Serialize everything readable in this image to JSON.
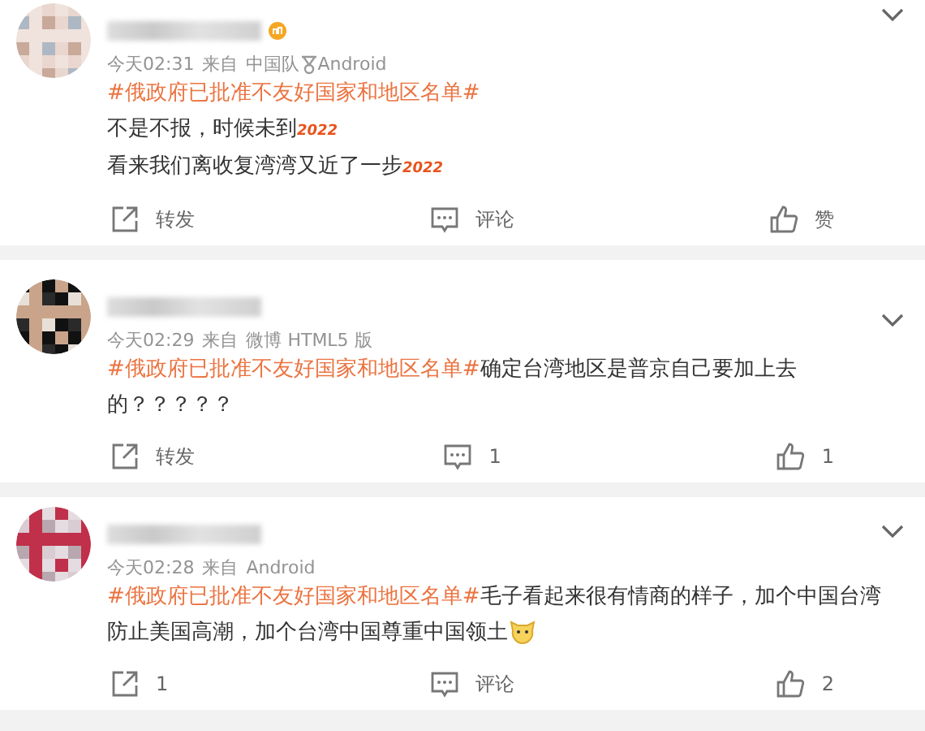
{
  "comments": [
    {
      "badge": true,
      "time": "今天02:31",
      "from": "来自",
      "source": [
        {
          "kind": "text",
          "text": "中国队"
        },
        {
          "kind": "icon"
        },
        {
          "kind": "text",
          "text": "Android"
        }
      ],
      "paragraphs": [
        [
          {
            "kind": "topic",
            "text": "#俄政府已批准不友好国家和地区名单#"
          }
        ],
        [
          {
            "kind": "text",
            "text": "不是不报，时候未到"
          },
          {
            "kind": "sticker",
            "text": "2022"
          }
        ],
        [
          {
            "kind": "text",
            "text": "看来我们离收复湾湾又近了一步"
          },
          {
            "kind": "sticker",
            "text": "2022"
          }
        ]
      ],
      "repost": "转发",
      "comment": "评论",
      "like": "赞"
    },
    {
      "badge": false,
      "time": "今天02:29",
      "from": "来自",
      "source": [
        {
          "kind": "text",
          "text": "微博 HTML5 版"
        }
      ],
      "paragraphs": [
        [
          {
            "kind": "topic",
            "text": "#俄政府已批准不友好国家和地区名单#"
          },
          {
            "kind": "text",
            "text": "确定台湾地区是普京自己要加上去的？？？？？"
          }
        ]
      ],
      "repost": "转发",
      "comment": "1",
      "like": "1"
    },
    {
      "badge": false,
      "time": "今天02:28",
      "from": "来自",
      "source": [
        {
          "kind": "text",
          "text": "Android"
        }
      ],
      "paragraphs": [
        [
          {
            "kind": "topic",
            "text": "#俄政府已批准不友好国家和地区名单#"
          },
          {
            "kind": "text",
            "text": "毛子看起来很有情商的样子，加个中国台湾防止美国高潮，加个台湾中国尊重中国领土"
          },
          {
            "kind": "emoji"
          }
        ]
      ],
      "repost": "1",
      "comment": "评论",
      "like": "2"
    }
  ]
}
